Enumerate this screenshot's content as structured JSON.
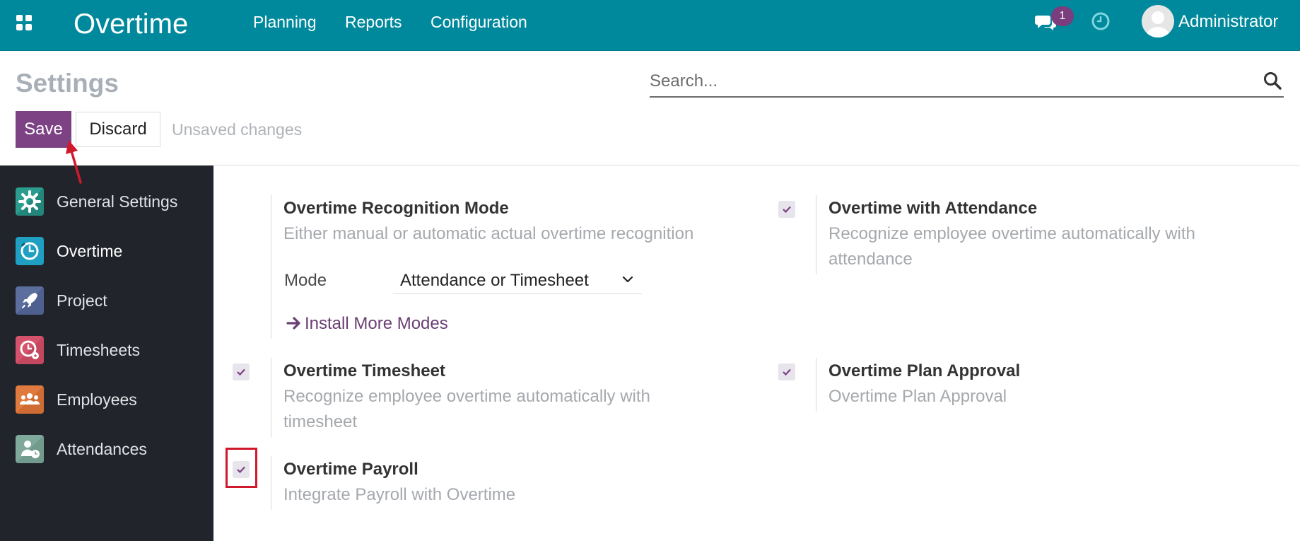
{
  "navbar": {
    "app_title": "Overtime",
    "menu": [
      "Planning",
      "Reports",
      "Configuration"
    ],
    "chat_badge": "1",
    "user_name": "Administrator",
    "bg_color": "#00899c"
  },
  "control_panel": {
    "title": "Settings",
    "search_placeholder": "Search...",
    "save_label": "Save",
    "discard_label": "Discard",
    "status": "Unsaved changes"
  },
  "sidebar": {
    "items": [
      {
        "label": "General Settings",
        "icon": "gear-icon",
        "color": "#2a9d8f",
        "active": false
      },
      {
        "label": "Overtime",
        "icon": "overtime-clock-icon",
        "color": "#1fa0c2",
        "active": true
      },
      {
        "label": "Project",
        "icon": "rocket-icon",
        "color": "#5b6e9e",
        "active": false
      },
      {
        "label": "Timesheets",
        "icon": "timesheet-icon",
        "color": "#d4526b",
        "active": false
      },
      {
        "label": "Employees",
        "icon": "people-icon",
        "color": "#e07a3f",
        "active": false
      },
      {
        "label": "Attendances",
        "icon": "attendance-icon",
        "color": "#7fa99b",
        "active": false
      }
    ]
  },
  "settings": {
    "recognition": {
      "title": "Overtime Recognition Mode",
      "desc": "Either manual or automatic actual overtime recognition",
      "mode_label": "Mode",
      "mode_value": "Attendance or Timesheet",
      "install_link": "Install More Modes"
    },
    "attendance": {
      "title": "Overtime with Attendance",
      "desc_line1": "Recognize employee overtime automatically with",
      "desc_line2": "attendance",
      "checked": true
    },
    "timesheet": {
      "title": "Overtime Timesheet",
      "desc_line1": "Recognize employee overtime automatically with",
      "desc_line2": "timesheet",
      "checked": true
    },
    "plan_approval": {
      "title": "Overtime Plan Approval",
      "desc": "Overtime Plan Approval",
      "checked": true
    },
    "payroll": {
      "title": "Overtime Payroll",
      "desc": "Integrate Payroll with Overtime",
      "checked": true
    }
  },
  "colors": {
    "primary": "#7c4284",
    "annotation": "#d0192b",
    "sidebar_bg": "#21252b"
  }
}
